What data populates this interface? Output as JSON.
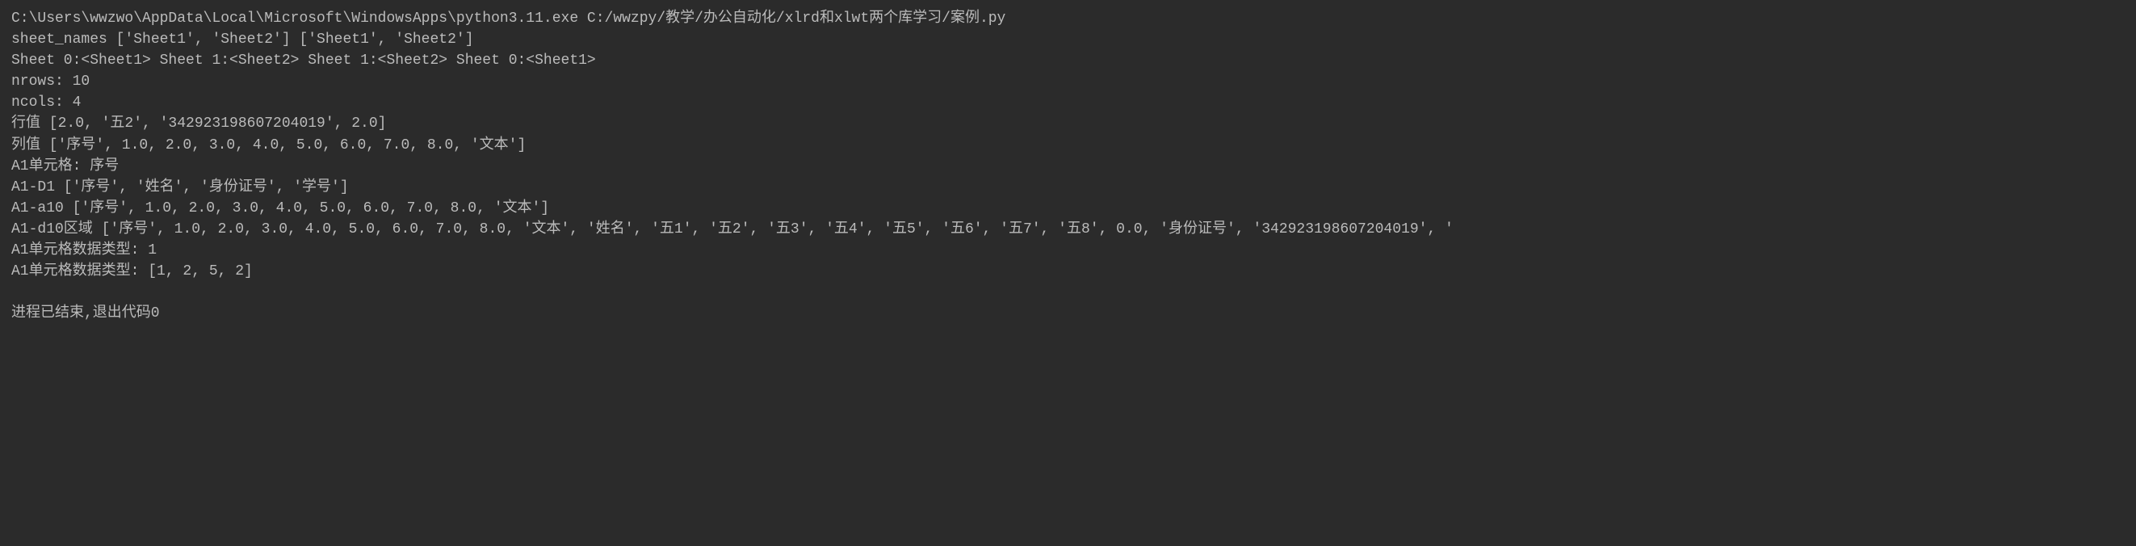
{
  "console": {
    "lines": [
      "C:\\Users\\wwzwo\\AppData\\Local\\Microsoft\\WindowsApps\\python3.11.exe C:/wwzpy/教学/办公自动化/xlrd和xlwt两个库学习/案例.py",
      "sheet_names ['Sheet1', 'Sheet2'] ['Sheet1', 'Sheet2']",
      "Sheet  0:<Sheet1> Sheet  1:<Sheet2> Sheet  1:<Sheet2> Sheet  0:<Sheet1>",
      "nrows: 10",
      "ncols: 4",
      "行值 [2.0, '五2', '342923198607204019', 2.0]",
      "列值 ['序号', 1.0, 2.0, 3.0, 4.0, 5.0, 6.0, 7.0, 8.0, '文本']",
      "A1单元格:  序号",
      "A1-D1 ['序号', '姓名', '身份证号', '学号']",
      "A1-a10 ['序号', 1.0, 2.0, 3.0, 4.0, 5.0, 6.0, 7.0, 8.0, '文本']",
      "A1-d10区域 ['序号', 1.0, 2.0, 3.0, 4.0, 5.0, 6.0, 7.0, 8.0, '文本', '姓名', '五1', '五2', '五3', '五4', '五5', '五6', '五7', '五8', 0.0, '身份证号', '342923198607204019', '",
      "A1单元格数据类型:  1",
      "A1单元格数据类型:  [1, 2, 5, 2]"
    ],
    "exit_message": "进程已结束,退出代码0"
  }
}
